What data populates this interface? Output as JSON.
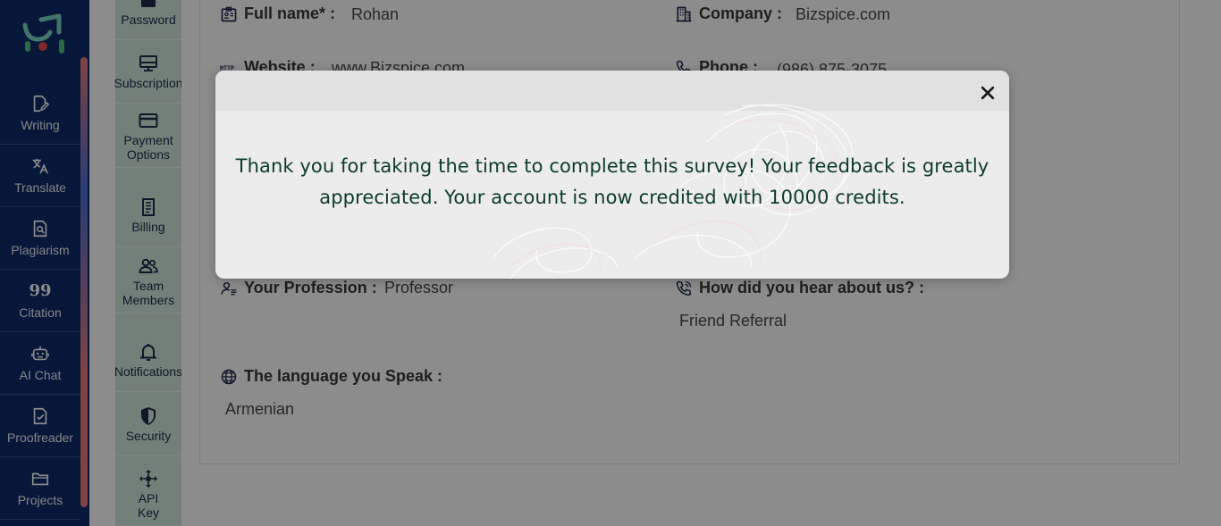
{
  "main_nav": {
    "items": [
      {
        "label": "Writing",
        "icon": "writing-icon"
      },
      {
        "label": "Translate",
        "icon": "translate-icon"
      },
      {
        "label": "Plagiarism",
        "icon": "plagiarism-icon"
      },
      {
        "label": "Citation",
        "icon": "citation-icon",
        "glyph": "99"
      },
      {
        "label": "AI Chat",
        "icon": "ai-chat-icon"
      },
      {
        "label": "Proofreader",
        "icon": "proofreader-icon"
      },
      {
        "label": "Projects",
        "icon": "projects-icon"
      }
    ]
  },
  "settings_nav": {
    "items": [
      {
        "label": "Password",
        "icon": "password-icon"
      },
      {
        "label": "Subscription",
        "icon": "subscription-icon"
      },
      {
        "label": "Payment\nOptions",
        "icon": "payment-card-icon"
      },
      {
        "label": "Billing",
        "icon": "billing-icon"
      },
      {
        "label": "Team\nMembers",
        "icon": "team-members-icon"
      },
      {
        "label": "Notifications",
        "icon": "bell-icon"
      },
      {
        "label": "Security",
        "icon": "shield-icon"
      },
      {
        "label": "API\nKey",
        "icon": "api-key-icon"
      }
    ]
  },
  "profile": {
    "full_name": {
      "label": "Full name* :",
      "value": "Rohan"
    },
    "company": {
      "label": "Company :",
      "value": "Bizspice.com"
    },
    "website": {
      "label": "Website :",
      "value": "www.Bizspice.com"
    },
    "phone": {
      "label": "Phone :",
      "value": "(986) 875-3075"
    },
    "profession": {
      "label": "Your Profession :",
      "value": "Professor"
    },
    "hear_about": {
      "label": "How did you hear about us? :",
      "value": "Friend Referral"
    },
    "language": {
      "label": "The language you Speak :",
      "value": "Armenian"
    }
  },
  "modal": {
    "message": "Thank you for taking the time to complete this survey! Your feedback is greatly appreciated. Your account is now credited with 10000 credits."
  },
  "colors": {
    "nav_bg": "#0b2a6b",
    "rail_bg": "#cfe9dd",
    "modal_text": "#0d3b2b"
  }
}
